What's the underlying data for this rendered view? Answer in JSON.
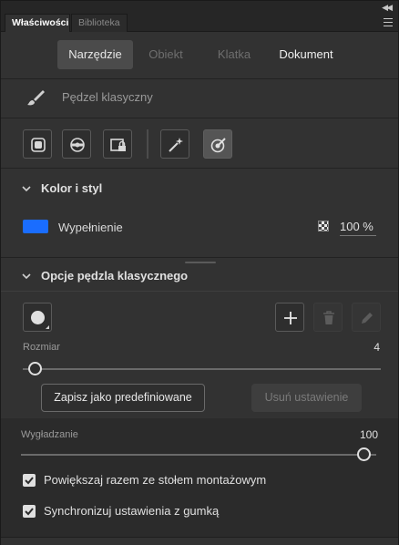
{
  "tabs": [
    {
      "label": "Właściwości",
      "active": true
    },
    {
      "label": "Biblioteka",
      "active": false
    }
  ],
  "segments": {
    "narzedzie": "Narzędzie",
    "obiekt": "Obiekt",
    "klatka": "Klatka",
    "dokument": "Dokument"
  },
  "tool": {
    "name": "Pędzel klasyczny",
    "icon": "brush-icon"
  },
  "tool_options": [
    {
      "name": "draw-inside-icon",
      "selected": false
    },
    {
      "name": "orbit-rotate-icon",
      "selected": false
    },
    {
      "name": "lock-fill-icon",
      "selected": false
    },
    {
      "name": "magic-pressure-icon",
      "selected": false
    },
    {
      "name": "target-brush-icon",
      "selected": true
    }
  ],
  "color_section": {
    "title": "Kolor i styl",
    "fill_label": "Wypełnienie",
    "fill_color": "#1a6dff",
    "opacity": "100 %"
  },
  "brush_section": {
    "title": "Opcje pędzla klasycznego",
    "size_label": "Rozmiar",
    "size_value": "4",
    "size_fraction": 0.0,
    "save_preset": "Zapisz jako predefiniowane",
    "delete_setting": "Usuń ustawienie",
    "smoothing_label": "Wygładzanie",
    "smoothing_value": "100",
    "smoothing_fraction": 1.0
  },
  "checkboxes": [
    {
      "label": "Powiększaj razem ze stołem montażowym",
      "checked": true
    },
    {
      "label": "Synchronizuj ustawienia z gumką",
      "checked": true
    }
  ]
}
